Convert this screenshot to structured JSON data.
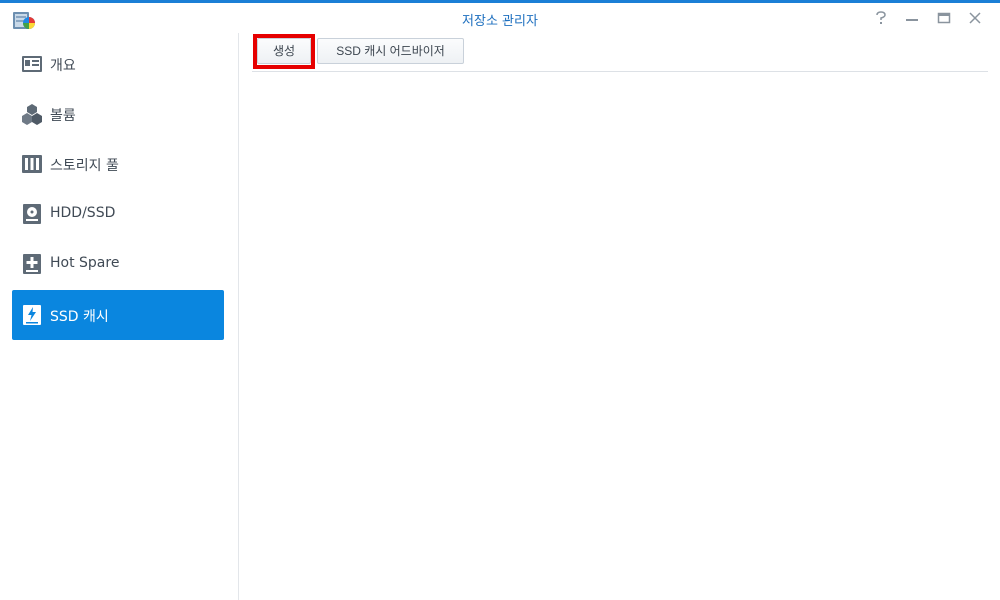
{
  "window": {
    "title": "저장소 관리자",
    "controls": [
      "help-icon",
      "minimize-icon",
      "maximize-icon",
      "close-icon"
    ]
  },
  "sidebar": {
    "items": [
      {
        "label": "개요",
        "icon": "overview-icon",
        "active": false
      },
      {
        "label": "볼륨",
        "icon": "volume-icon",
        "active": false
      },
      {
        "label": "스토리지 풀",
        "icon": "storage-pool-icon",
        "active": false
      },
      {
        "label": "HDD/SSD",
        "icon": "hdd-icon",
        "active": false
      },
      {
        "label": "Hot Spare",
        "icon": "hot-spare-icon",
        "active": false
      },
      {
        "label": "SSD 캐시",
        "icon": "ssd-cache-icon",
        "active": true
      }
    ]
  },
  "toolbar": {
    "create_label": "생성",
    "advisor_label": "SSD 캐시 어드바이저"
  },
  "colors": {
    "accent": "#0a86df",
    "title": "#1d6fbf",
    "highlight": "#e60000"
  }
}
